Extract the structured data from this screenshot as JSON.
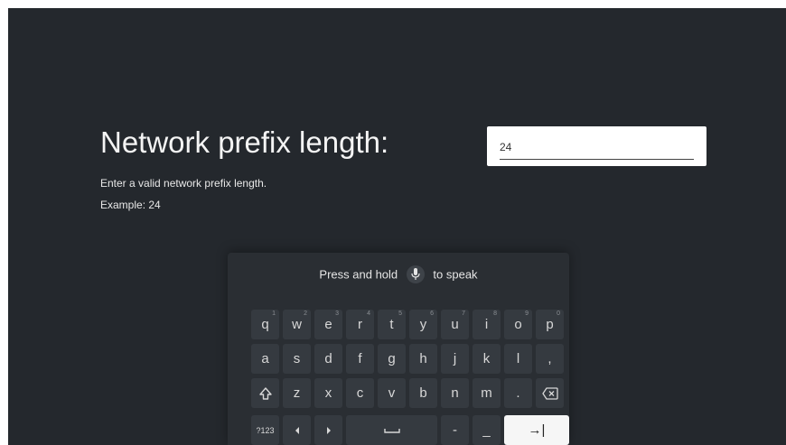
{
  "page": {
    "title": "Network prefix length:",
    "description": "Enter a valid network prefix length.",
    "example": "Example: 24"
  },
  "input": {
    "value": "24"
  },
  "keyboard": {
    "hint_before": "Press and hold",
    "hint_after": "to speak",
    "row1": [
      {
        "label": "q",
        "num": "1"
      },
      {
        "label": "w",
        "num": "2"
      },
      {
        "label": "e",
        "num": "3"
      },
      {
        "label": "r",
        "num": "4"
      },
      {
        "label": "t",
        "num": "5"
      },
      {
        "label": "y",
        "num": "6"
      },
      {
        "label": "u",
        "num": "7"
      },
      {
        "label": "i",
        "num": "8"
      },
      {
        "label": "o",
        "num": "9"
      },
      {
        "label": "p",
        "num": "0"
      }
    ],
    "row2": [
      "a",
      "s",
      "d",
      "f",
      "g",
      "h",
      "j",
      "k",
      "l",
      ","
    ],
    "row3": [
      "z",
      "x",
      "c",
      "v",
      "b",
      "n",
      "m",
      "."
    ],
    "mode_label": "?123",
    "dash_label": "-",
    "underscore_label": "_",
    "enter_label": "→|"
  }
}
